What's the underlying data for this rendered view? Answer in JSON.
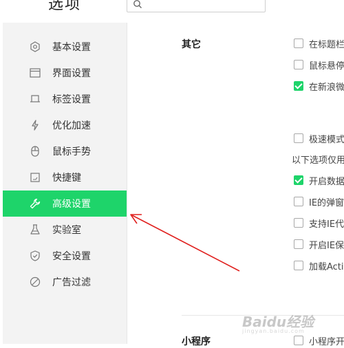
{
  "window": {
    "title": "选项"
  },
  "search": {
    "placeholder": ""
  },
  "sidebar": {
    "items": [
      {
        "label": "基本设置",
        "icon": "hexagon-icon"
      },
      {
        "label": "界面设置",
        "icon": "window-icon"
      },
      {
        "label": "标签设置",
        "icon": "tab-icon"
      },
      {
        "label": "优化加速",
        "icon": "lightning-icon"
      },
      {
        "label": "鼠标手势",
        "icon": "mouse-icon"
      },
      {
        "label": "快捷键",
        "icon": "keyboard-icon"
      },
      {
        "label": "高级设置",
        "icon": "wrench-icon",
        "active": true
      },
      {
        "label": "实验室",
        "icon": "flask-icon"
      },
      {
        "label": "安全设置",
        "icon": "shield-icon"
      },
      {
        "label": "广告过滤",
        "icon": "ban-icon"
      }
    ]
  },
  "main": {
    "sections": [
      {
        "label": "其它"
      },
      {
        "label": "小程序"
      }
    ],
    "options": [
      {
        "text": "在标题栏",
        "checked": false
      },
      {
        "text": "鼠标悬停",
        "checked": false
      },
      {
        "text": "在新浪微",
        "checked": true
      },
      {
        "text": "极速模式",
        "checked": false
      },
      {
        "text": "开启数据",
        "checked": true
      },
      {
        "text": "IE的弹窗",
        "checked": false
      },
      {
        "text": "支持IE代",
        "checked": false
      },
      {
        "text": "开启IE保",
        "checked": false
      },
      {
        "text": "加载Activ",
        "checked": false
      },
      {
        "text": "小程序开",
        "checked": false
      }
    ],
    "info_line": "以下选项仅用"
  },
  "watermark": {
    "text": "Baidu经验",
    "sub": "jingyan.baidu.com"
  },
  "colors": {
    "accent": "#1ed46a",
    "annotation": "#e0201e"
  }
}
